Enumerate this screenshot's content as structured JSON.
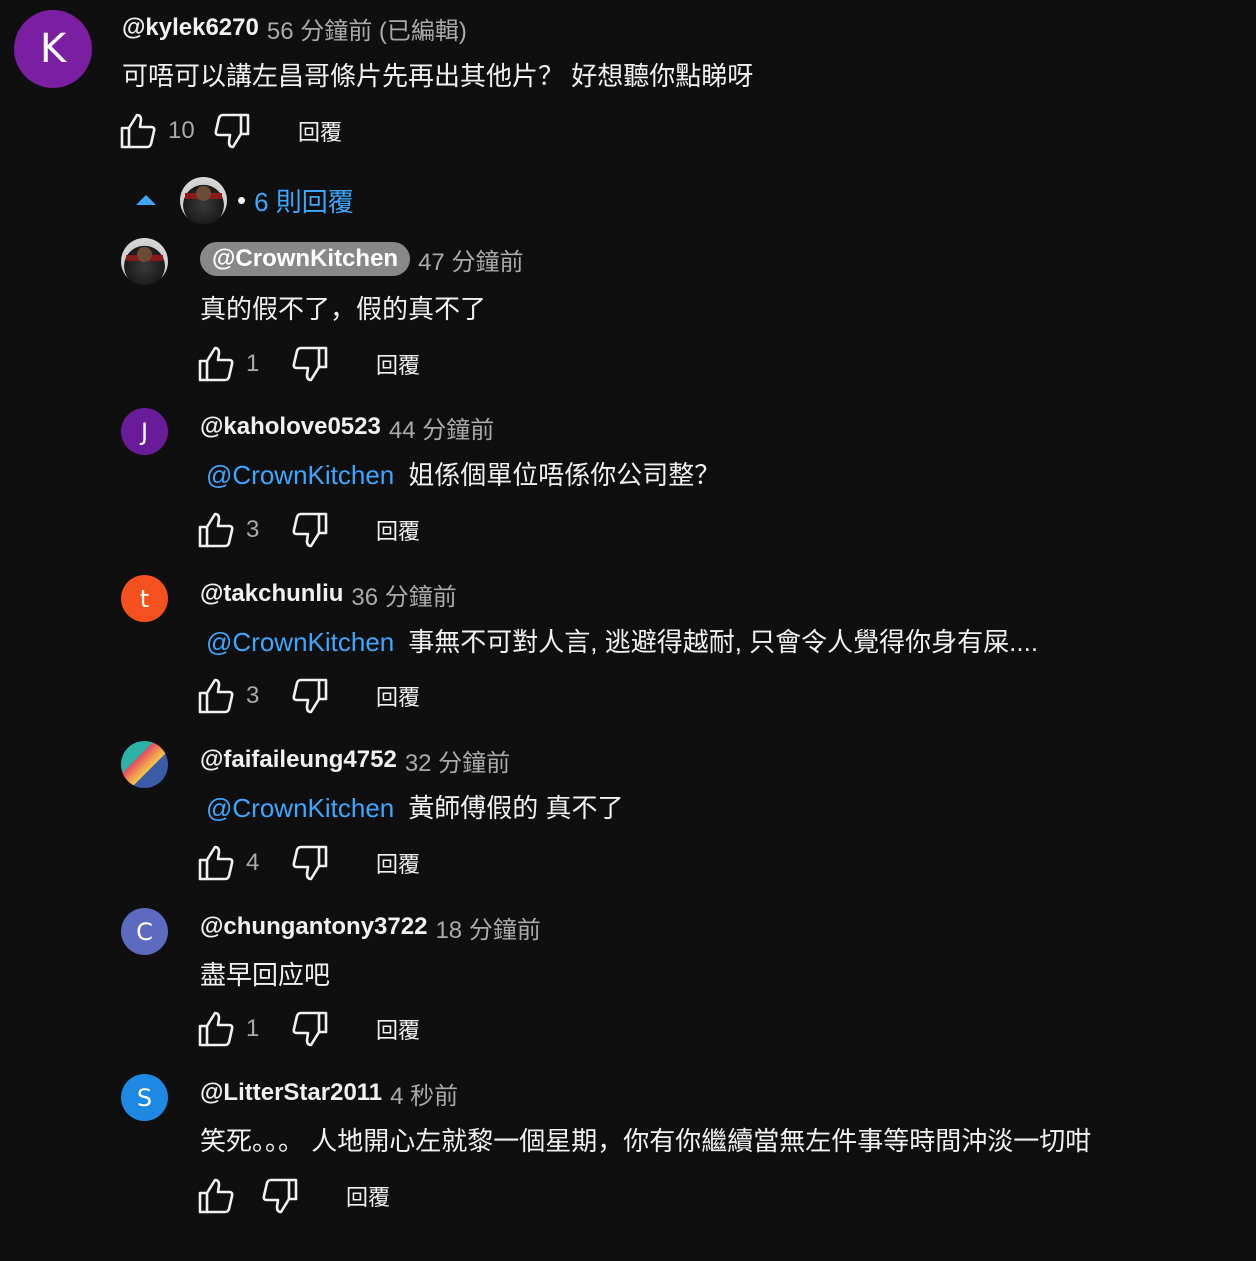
{
  "colors": {
    "background": "#0f0f0f",
    "link": "#3ea6ff",
    "avatar_k": "#7b1fa2",
    "avatar_j": "#6a1b9a",
    "avatar_t": "#f4511e",
    "avatar_c": "#5c6bc0",
    "avatar_s": "#1e88e5"
  },
  "icons": {
    "like": "thumbs-up-icon",
    "dislike": "thumbs-down-icon",
    "collapse": "caret-up-icon"
  },
  "top_comment": {
    "avatar_letter": "K",
    "handle": "@kylek6270",
    "time": "56 分鐘前 (已編輯)",
    "text": "可唔可以講左昌哥條片先再出其他片？ 好想聽你點睇呀",
    "likes": "10",
    "reply_label": "回覆"
  },
  "replies_toggle": {
    "separator": "•",
    "label": "6 則回覆"
  },
  "replies": [
    {
      "avatar_letter": "",
      "handle": "@CrownKitchen",
      "time": "47 分鐘前",
      "mention": "",
      "text": "真的假不了，假的真不了",
      "likes": "1",
      "reply_label": "回覆"
    },
    {
      "avatar_letter": "J",
      "handle": "@kaholove0523",
      "time": "44 分鐘前",
      "mention": "@CrownKitchen",
      "text": "姐係個單位唔係你公司整？",
      "likes": "3",
      "reply_label": "回覆"
    },
    {
      "avatar_letter": "t",
      "handle": "@takchunliu",
      "time": "36 分鐘前",
      "mention": "@CrownKitchen",
      "text": "事無不可對人言, 逃避得越耐, 只會令人覺得你身有屎....",
      "likes": "3",
      "reply_label": "回覆"
    },
    {
      "avatar_letter": "",
      "handle": "@faifaileung4752",
      "time": "32 分鐘前",
      "mention": "@CrownKitchen",
      "text": "黃師傅假的 真不了",
      "likes": "4",
      "reply_label": "回覆"
    },
    {
      "avatar_letter": "C",
      "handle": "@chungantony3722",
      "time": "18 分鐘前",
      "mention": "",
      "text": "盡早回应吧",
      "likes": "1",
      "reply_label": "回覆"
    },
    {
      "avatar_letter": "S",
      "handle": "@LitterStar2011",
      "time": "4 秒前",
      "mention": "",
      "text": "笑死。。。 人地開心左就黎一個星期，你有你繼續當無左件事等時間沖淡一切咁",
      "likes": "",
      "reply_label": "回覆"
    }
  ]
}
